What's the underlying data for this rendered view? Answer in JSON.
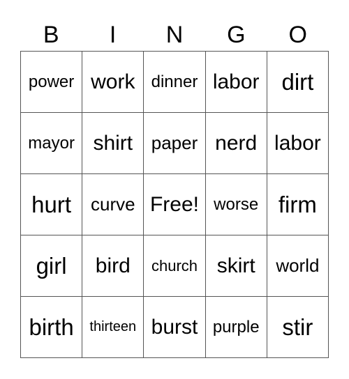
{
  "header": {
    "letters": [
      "B",
      "I",
      "N",
      "G",
      "O"
    ]
  },
  "board": {
    "rows": [
      [
        {
          "text": "power",
          "size": "s-s"
        },
        {
          "text": "work",
          "size": "s-l"
        },
        {
          "text": "dinner",
          "size": "s-s"
        },
        {
          "text": "labor",
          "size": "s-l"
        },
        {
          "text": "dirt",
          "size": "s-xl"
        }
      ],
      [
        {
          "text": "mayor",
          "size": "s-s"
        },
        {
          "text": "shirt",
          "size": "s-l"
        },
        {
          "text": "paper",
          "size": "s-m"
        },
        {
          "text": "nerd",
          "size": "s-l"
        },
        {
          "text": "labor",
          "size": "s-l"
        }
      ],
      [
        {
          "text": "hurt",
          "size": "s-xl"
        },
        {
          "text": "curve",
          "size": "s-m"
        },
        {
          "text": "Free!",
          "size": "s-l"
        },
        {
          "text": "worse",
          "size": "s-s"
        },
        {
          "text": "firm",
          "size": "s-xl"
        }
      ],
      [
        {
          "text": "girl",
          "size": "s-xl"
        },
        {
          "text": "bird",
          "size": "s-l"
        },
        {
          "text": "church",
          "size": "s-xs"
        },
        {
          "text": "skirt",
          "size": "s-l"
        },
        {
          "text": "world",
          "size": "s-m"
        }
      ],
      [
        {
          "text": "birth",
          "size": "s-xl"
        },
        {
          "text": "thirteen",
          "size": "s-xxs"
        },
        {
          "text": "burst",
          "size": "s-l"
        },
        {
          "text": "purple",
          "size": "s-s"
        },
        {
          "text": "stir",
          "size": "s-xl"
        }
      ]
    ]
  }
}
